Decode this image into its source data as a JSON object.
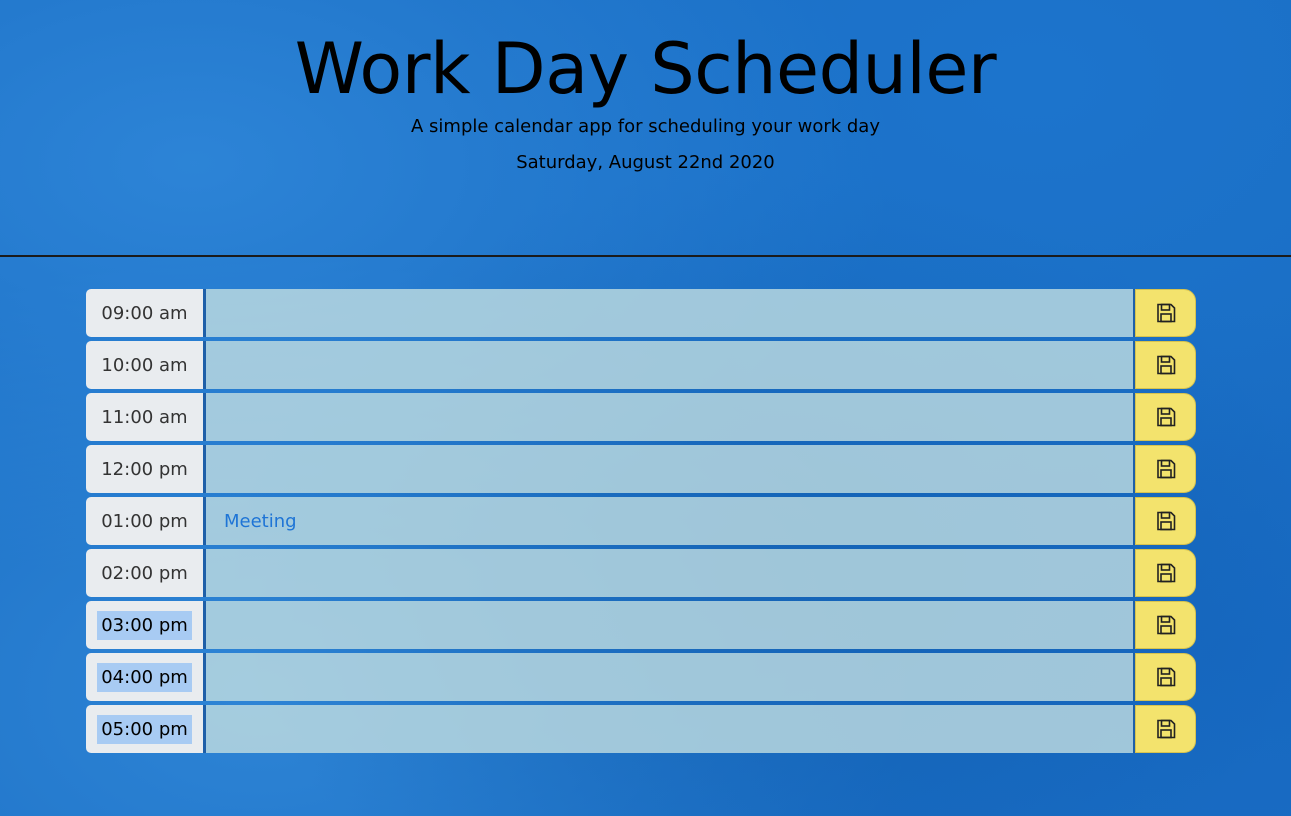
{
  "header": {
    "title": "Work Day Scheduler",
    "subtitle": "A simple calendar app for scheduling your work day",
    "current_day": "Saturday, August 22nd 2020"
  },
  "colors": {
    "background": "#1a6ec4",
    "hour_block": "#e9ecef",
    "past_row": "#bedce1",
    "save_button": "#f3e36d",
    "event_text": "#1e74d6"
  },
  "schedule": [
    {
      "hour": "09:00 am",
      "event": "",
      "selected": false
    },
    {
      "hour": "10:00 am",
      "event": "",
      "selected": false
    },
    {
      "hour": "11:00 am",
      "event": "",
      "selected": false
    },
    {
      "hour": "12:00 pm",
      "event": "",
      "selected": false
    },
    {
      "hour": "01:00 pm",
      "event": "Meeting",
      "selected": false
    },
    {
      "hour": "02:00 pm",
      "event": "",
      "selected": false
    },
    {
      "hour": "03:00 pm",
      "event": "",
      "selected": true
    },
    {
      "hour": "04:00 pm",
      "event": "",
      "selected": true
    },
    {
      "hour": "05:00 pm",
      "event": "",
      "selected": true
    }
  ],
  "save_icon": "floppy-disk-icon"
}
